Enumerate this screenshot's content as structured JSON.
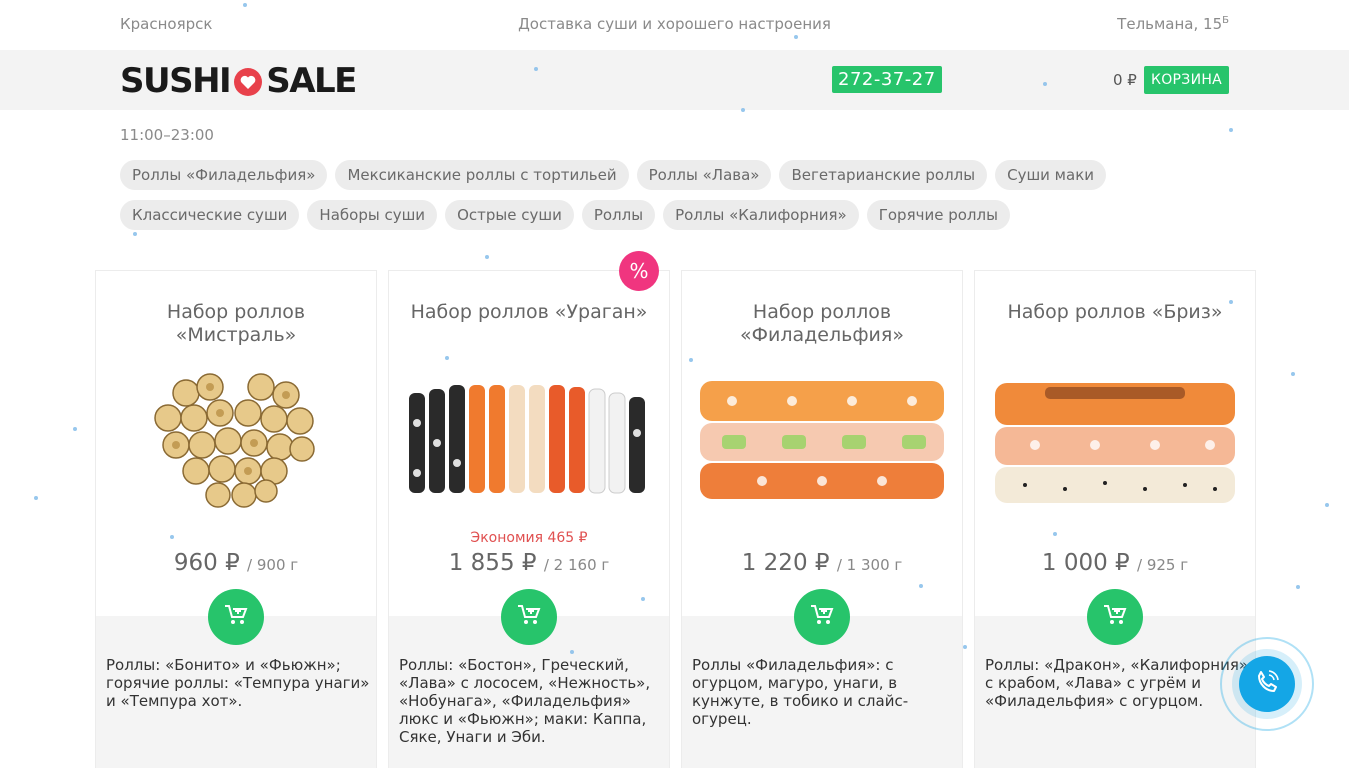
{
  "topbar": {
    "city": "Красноярск",
    "tagline": "Доставка суши и хорошего настроения",
    "address": "Тельмана, 15",
    "address_sup": "Б"
  },
  "header": {
    "logo_left": "SUSHI",
    "logo_right": "SALE",
    "phone": "272-37-27",
    "cart_sum": "0 ₽",
    "cart_label": "КОРЗИНА"
  },
  "hours": "11:00–23:00",
  "categories": [
    "Роллы «Филадельфия»",
    "Мексиканские роллы с тортильей",
    "Роллы «Лава»",
    "Вегетарианские роллы",
    "Суши маки",
    "Классические суши",
    "Наборы суши",
    "Острые суши",
    "Роллы",
    "Роллы «Калифорния»",
    "Горячие роллы"
  ],
  "sale_badge": "%",
  "products": [
    {
      "title": "Набор роллов «Мистраль»",
      "saving": "",
      "price": "960 ₽",
      "weight": "/ 900 г",
      "description": "Роллы: «Бонито» и «Фьюжн»; горячие роллы: «Темпура унаги» и «Темпура хот»."
    },
    {
      "title": "Набор роллов «Ураган»",
      "saving": "Экономия 465 ₽",
      "price": "1 855 ₽",
      "weight": "/ 2 160 г",
      "description": "Роллы: «Бостон», Греческий, «Лава» с лососем, «Нежность», «Нобунага», «Филадельфия» люкс и «Фьюжн»; маки: Каппа, Сяке, Унаги и Эби."
    },
    {
      "title": "Набор роллов «Филадельфия»",
      "saving": "",
      "price": "1 220 ₽",
      "weight": "/ 1 300 г",
      "description": "Роллы «Филадельфия»: с огурцом, магуро, унаги, в кунжуте, в тобико и слайс-огурец."
    },
    {
      "title": "Набор роллов «Бриз»",
      "saving": "",
      "price": "1 000 ₽",
      "weight": "/ 925 г",
      "description": "Роллы: «Дракон», «Калифорния» с крабом, «Лава» с угрём и «Филадельфия» с огурцом."
    }
  ],
  "icons": {
    "logo_heart": "heart-icon",
    "add_to_cart": "cart-plus-icon",
    "call": "phone-icon"
  },
  "colors": {
    "accent_green": "#27c46b",
    "sale_pink": "#f0357f",
    "call_blue": "#14a6e6",
    "logo_red": "#e8414b"
  }
}
